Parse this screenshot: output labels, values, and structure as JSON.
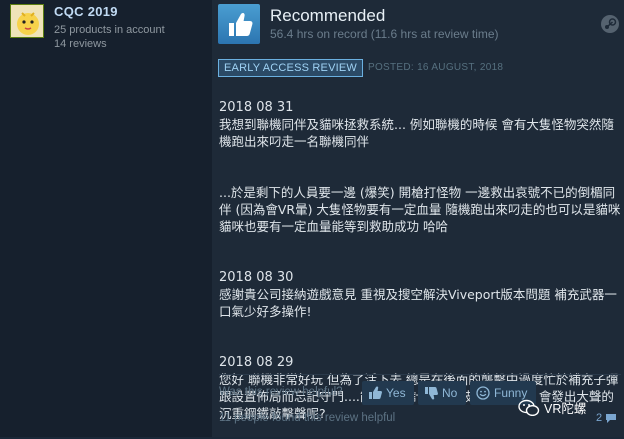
{
  "profile": {
    "name": "CQC 2019",
    "products": "25 products in account",
    "reviews": "14 reviews"
  },
  "review": {
    "verdict": "Recommended",
    "hours": "56.4 hrs on record (11.6 hrs at review time)",
    "badge": "EARLY ACCESS REVIEW",
    "posted": "POSTED: 16 AUGUST, 2018",
    "paragraphs": [
      {
        "date": "2018 08 31",
        "text": "我想到聯機同伴及貓咪拯救系統... 例如聯機的時候 會有大隻怪物突然隨機跑出來叼走一名聯機同伴"
      },
      {
        "date": "",
        "text": "...於是剩下的人員要一邊 (爆笑) 開槍打怪物 一邊救出哀號不已的倒楣同伴 (因為會VR暈) 大隻怪物要有一定血量 隨機跑出來叼走的也可以是貓咪 貓咪也要有一定血量能等到救助成功 哈哈"
      },
      {
        "date": "2018 08 30",
        "text": "感謝貴公司接納遊戲意見 重視及搜空解決Viveport版本問題 補充武器一口氣少好多操作!"
      },
      {
        "date": "2018 08 29",
        "text": "您好 聯機非常好玩 但為了活下去 總是在後面的襲擊中過度忙於補充子彈跟設置佈局而忘記守門....能不能設計讓門在被喪屍攻擊時 會發出大聲的沉重鋼鐵敲擊聲呢?"
      }
    ],
    "helpful_question": "Was this review helpful?",
    "yes_label": "Yes",
    "no_label": "No",
    "funny_label": "Funny",
    "found_helpful": "11 people found this review helpful",
    "comment_count": "2"
  },
  "watermark": {
    "text": "VR陀螺"
  },
  "colors": {
    "background": "#1b2838",
    "accent_blue": "#6bb0e0",
    "thumb_blue": "#3d8cc4"
  },
  "icons": [
    "thumbs-up-icon",
    "steam-icon",
    "thumbs-down-icon",
    "smiley-icon",
    "comment-icon",
    "wechat-logo"
  ]
}
